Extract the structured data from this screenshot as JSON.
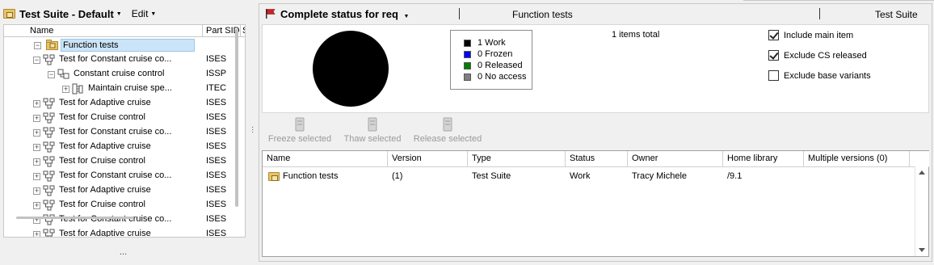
{
  "left": {
    "suite_title": "Test Suite - Default",
    "edit_label": "Edit",
    "columns": [
      "Name",
      "Part SID",
      "S"
    ],
    "tree": [
      {
        "label": "Function tests",
        "sid": "",
        "indent": 0,
        "expander": "minus",
        "icon": "folder",
        "selected": true
      },
      {
        "label": "Test for Constant cruise co...",
        "sid": "ISES",
        "indent": 1,
        "expander": "minus",
        "icon": "req"
      },
      {
        "label": "Constant cruise control",
        "sid": "ISSP",
        "indent": 2,
        "expander": "minus",
        "icon": "req2"
      },
      {
        "label": "Maintain cruise spe...",
        "sid": "ITEC",
        "indent": 3,
        "expander": "plus",
        "icon": "req3"
      },
      {
        "label": "Test for Adaptive cruise",
        "sid": "ISES",
        "indent": 1,
        "expander": "plus",
        "icon": "req"
      },
      {
        "label": "Test for Cruise control",
        "sid": "ISES",
        "indent": 1,
        "expander": "plus",
        "icon": "req"
      },
      {
        "label": "Test for Constant cruise co...",
        "sid": "ISES",
        "indent": 1,
        "expander": "plus",
        "icon": "req"
      },
      {
        "label": "Test for Adaptive cruise",
        "sid": "ISES",
        "indent": 1,
        "expander": "plus",
        "icon": "req"
      },
      {
        "label": "Test for Cruise control",
        "sid": "ISES",
        "indent": 1,
        "expander": "plus",
        "icon": "req"
      },
      {
        "label": "Test for Constant cruise co...",
        "sid": "ISES",
        "indent": 1,
        "expander": "plus",
        "icon": "req"
      },
      {
        "label": "Test for Adaptive cruise",
        "sid": "ISES",
        "indent": 1,
        "expander": "plus",
        "icon": "req"
      },
      {
        "label": "Test for Cruise control",
        "sid": "ISES",
        "indent": 1,
        "expander": "plus",
        "icon": "req"
      },
      {
        "label": "Test for Constant cruise co...",
        "sid": "ISES",
        "indent": 1,
        "expander": "plus",
        "icon": "req"
      },
      {
        "label": "Test for Adaptive cruise",
        "sid": "ISES",
        "indent": 1,
        "expander": "plus",
        "icon": "req"
      }
    ],
    "more_label": "..."
  },
  "right": {
    "status_title": "Complete status for req",
    "context_item": "Function tests",
    "context_type": "Test Suite",
    "items_total": "1 items total",
    "legend": [
      {
        "label": "1 Work",
        "color": "#000000",
        "count": 1
      },
      {
        "label": "0 Frozen",
        "color": "#0000ff",
        "count": 0
      },
      {
        "label": "0 Released",
        "color": "#008000",
        "count": 0
      },
      {
        "label": "0 No access",
        "color": "#808080",
        "count": 0
      }
    ],
    "options": [
      {
        "label": "Include main item",
        "checked": true
      },
      {
        "label": "Exclude CS released",
        "checked": true
      },
      {
        "label": "Exclude base variants",
        "checked": false
      }
    ],
    "toolbar": {
      "freeze": "Freeze selected",
      "thaw": "Thaw selected",
      "release": "Release selected"
    },
    "grid": {
      "columns": [
        "Name",
        "Version",
        "Type",
        "Status",
        "Owner",
        "Home library",
        "Multiple versions (0)"
      ],
      "rows": [
        {
          "name": "Function tests",
          "version": "(1)",
          "type": "Test Suite",
          "status": "Work",
          "owner": "Tracy Michele",
          "home_library": "/9.1",
          "multiple_versions": ""
        }
      ]
    }
  }
}
